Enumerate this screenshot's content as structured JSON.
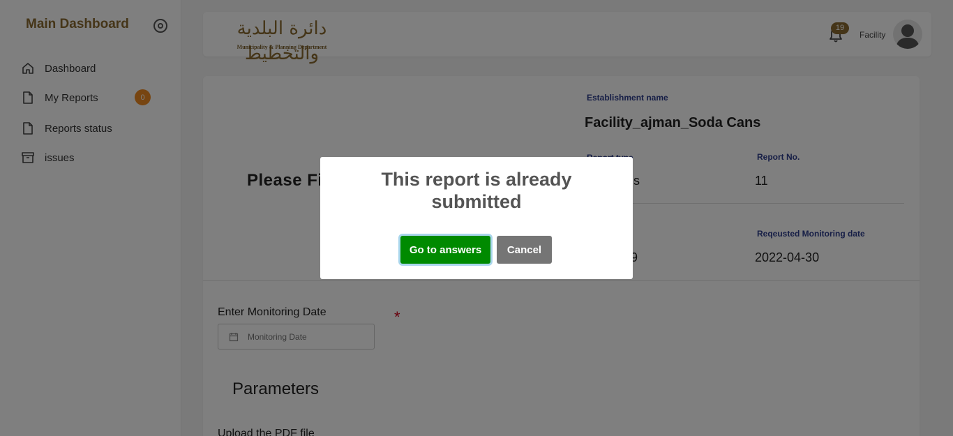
{
  "sidebar": {
    "title": "Main Dashboard",
    "items": [
      {
        "label": "Dashboard",
        "icon": "home-icon"
      },
      {
        "label": "My Reports",
        "icon": "file-icon",
        "badge": "0"
      },
      {
        "label": "Reports status",
        "icon": "file-icon"
      },
      {
        "label": "issues",
        "icon": "archive-icon"
      }
    ]
  },
  "header": {
    "logo_arabic": "دائرة البلدية والتخطيط",
    "logo_english": "Municipality & Planning Department",
    "notification_count": "19",
    "user_name": "Facility"
  },
  "main": {
    "heading": "Please Fi",
    "establishment_label": "Establishment name",
    "establishment_value": "Facility_ajman_Soda Cans",
    "report_type_label": "Report type",
    "report_type_value": "ous",
    "report_no_label": "Report No.",
    "report_no_value": "11",
    "date_value": "-29",
    "requested_date_label": "Reqeusted Monitoring date",
    "requested_date_value": "2022-04-30",
    "monitoring_date_label": "Enter Monitoring Date",
    "monitoring_date_required": "*",
    "monitoring_date_placeholder": "Monitoring Date",
    "parameters_heading": "Parameters",
    "upload_label": "Upload the PDF file"
  },
  "modal": {
    "title": "This report is already submitted",
    "confirm_label": "Go to answers",
    "cancel_label": "Cancel"
  },
  "colors": {
    "brand": "#8a6b30",
    "label_blue": "#2d3c8c",
    "badge_orange": "#ee8a22",
    "confirm_green": "#008a00",
    "cancel_gray": "#757575",
    "required_red": "#d0021b"
  }
}
